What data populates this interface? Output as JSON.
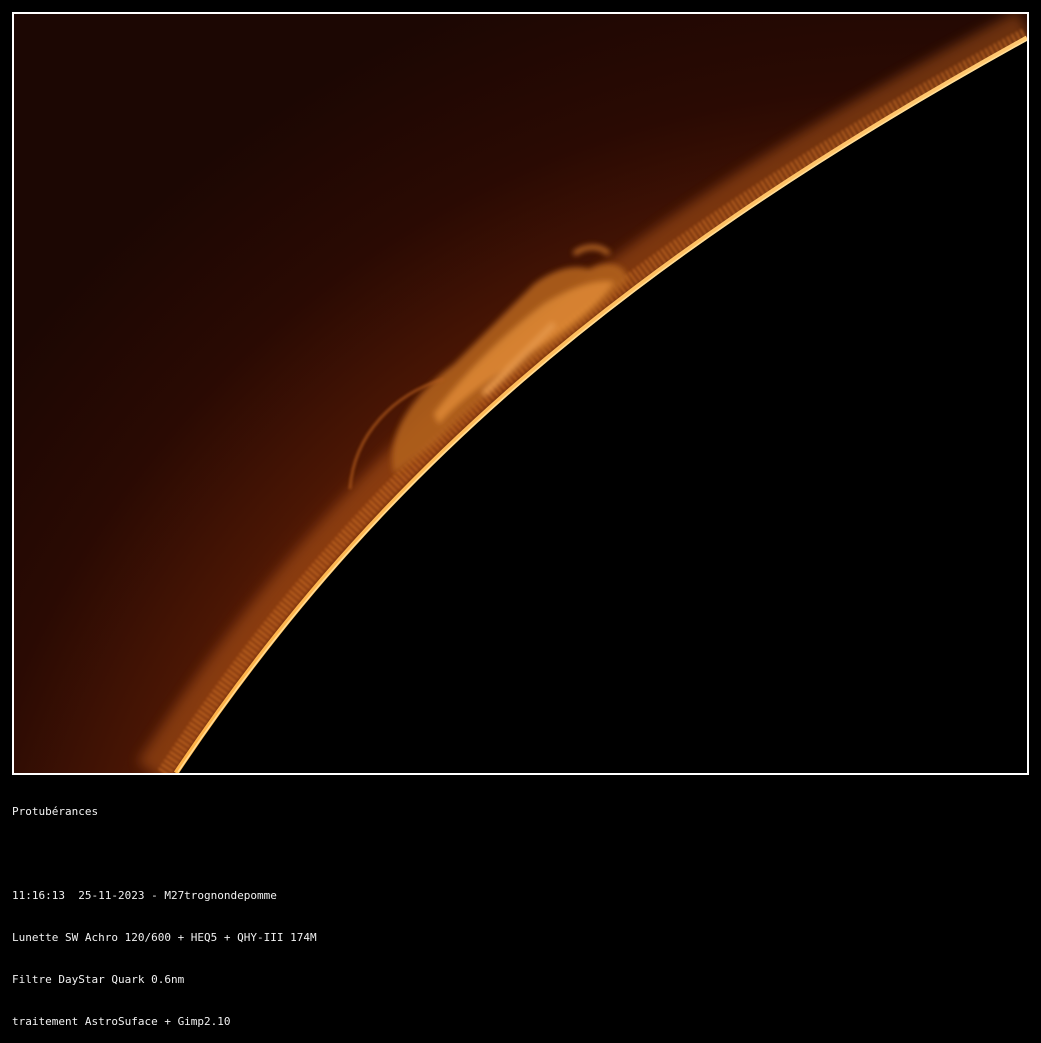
{
  "image": {
    "subject": "solar-limb-prominence",
    "colors": {
      "sky_dark": "#1a0702",
      "sky_glow": "#5a1c05",
      "limb": "#ffb347",
      "limb_core": "#ffdf9a",
      "prominence": "#d9822b",
      "disk": "#000000",
      "frame_border": "#ffffff"
    }
  },
  "caption": {
    "title": "Protubérances",
    "blank": "",
    "line1": "11:16:13  25-11-2023 - M27trognondepomme",
    "line2": "Lunette SW Achro 120/600 + HEQ5 + QHY-III 174M",
    "line3": "Filtre DayStar Quark 0.6nm",
    "line4": "traitement AstroSuface + Gimp2.10"
  }
}
